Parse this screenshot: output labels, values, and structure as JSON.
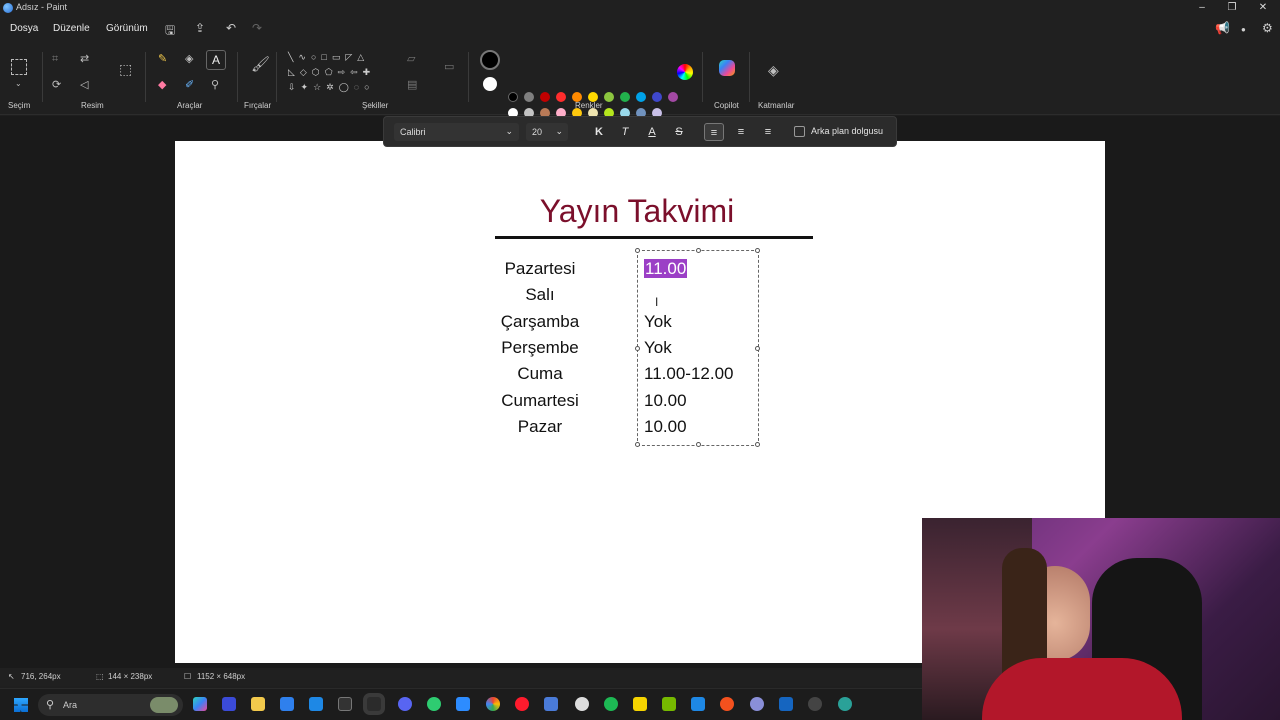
{
  "window": {
    "title": "Adsız - Paint"
  },
  "menu": {
    "file": "Dosya",
    "edit": "Düzenle",
    "view": "Görünüm"
  },
  "ribbon": {
    "groups": {
      "selection": "Seçim",
      "image": "Resim",
      "tools": "Araçlar",
      "brushes": "Fırçalar",
      "shapes": "Şekiller",
      "colors": "Renkler",
      "copilot": "Copilot",
      "layers": "Katmanlar"
    },
    "palette_row1": [
      "#000000",
      "#7f7f7f",
      "#c00000",
      "#ff2d2d",
      "#ff8a00",
      "#ffd800",
      "#8cc63f",
      "#22b14c",
      "#00a2e8",
      "#3f48cc",
      "#a349a4"
    ],
    "palette_row2": [
      "#ffffff",
      "#c3c3c3",
      "#b97a57",
      "#ffaec9",
      "#ffc90e",
      "#efe4b0",
      "#b5e61d",
      "#99d9ea",
      "#7092be",
      "#c8bfe7"
    ]
  },
  "textbar": {
    "font": "Calibri",
    "size": "20",
    "bold_label": "K",
    "italic_label": "T",
    "underline_label": "A",
    "strike_label": "S",
    "background_fill_label": "Arka plan dolgusu"
  },
  "document": {
    "title": "Yayın Takvimi",
    "days": [
      "Pazartesi",
      "Salı",
      "Çarşamba",
      "Perşembe",
      "Cuma",
      "Cumartesi",
      "Pazar"
    ],
    "times": [
      "11.00",
      "",
      "Yok",
      "Yok",
      "11.00-12.00",
      "10.00",
      "10.00"
    ],
    "title_color": "#7b0f2b",
    "selection_color": "#9b3fc6"
  },
  "statusbar": {
    "cursor_pos": "716, 264px",
    "selection_size": "144 × 238px",
    "canvas_size": "1152 × 648px"
  },
  "taskbar": {
    "search_placeholder": "Ara"
  }
}
